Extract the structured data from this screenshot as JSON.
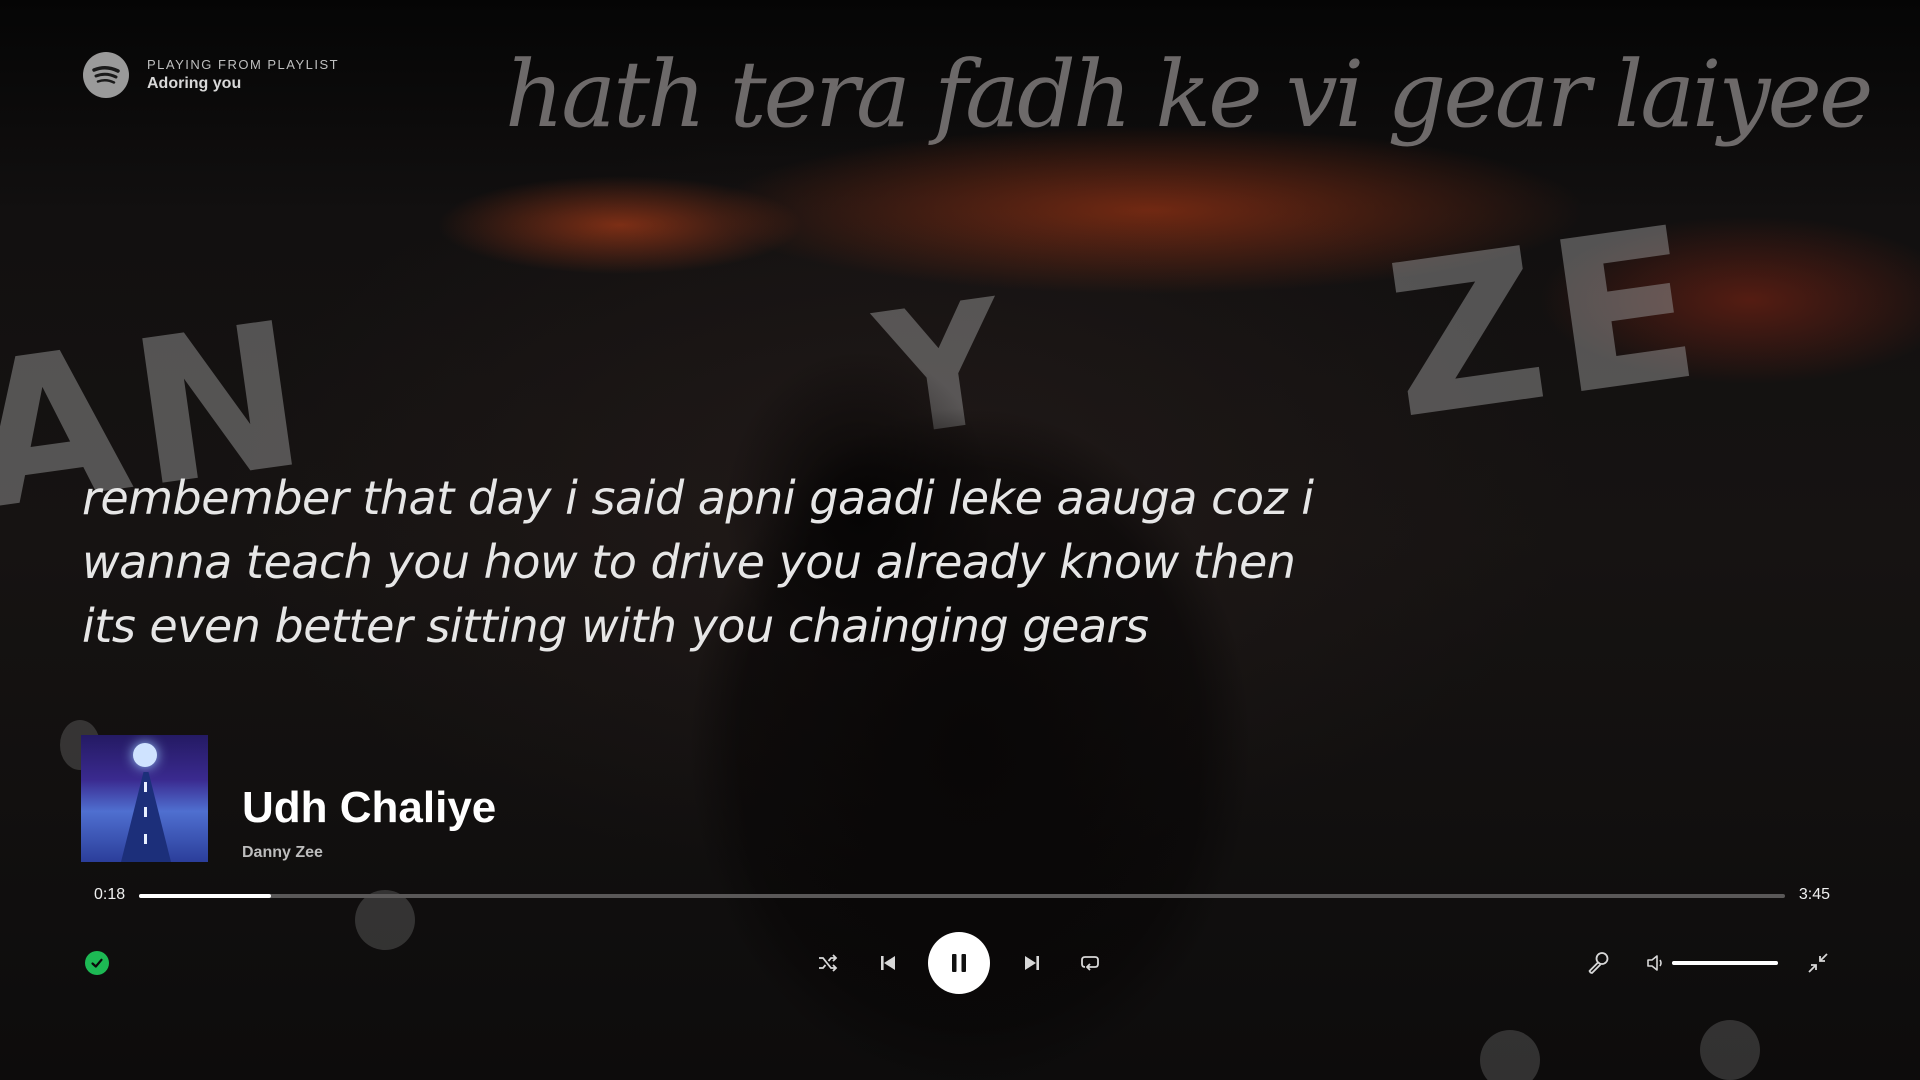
{
  "header": {
    "playing_from_label": "PLAYING FROM PLAYLIST",
    "playlist_name": "Adoring you"
  },
  "lyrics": {
    "headline": "hath tera fadh ke vi gear laiyee",
    "current": "rembember that day i said apni gaadi leke aauga coz i wanna teach you how to drive you already know then its even better sitting with you chainging gears"
  },
  "track": {
    "title": "Udh Chaliye",
    "artist": "Danny Zee",
    "liked": true
  },
  "progress": {
    "elapsed": "0:18",
    "total": "3:45",
    "fraction": 0.08
  },
  "volume": {
    "fraction": 1.0
  },
  "icons": {
    "logo": "spotify-logo-icon",
    "liked": "check-icon",
    "shuffle": "shuffle-icon",
    "previous": "skip-back-icon",
    "play_state": "pause-icon",
    "next": "skip-forward-icon",
    "repeat": "repeat-icon",
    "lyrics": "microphone-icon",
    "volume": "volume-icon",
    "exit_fullscreen": "minimize-icon"
  },
  "colors": {
    "accent": "#1db954",
    "text": "#ffffff",
    "muted": "#bdbdbd",
    "track_bg": "#5a5858"
  }
}
